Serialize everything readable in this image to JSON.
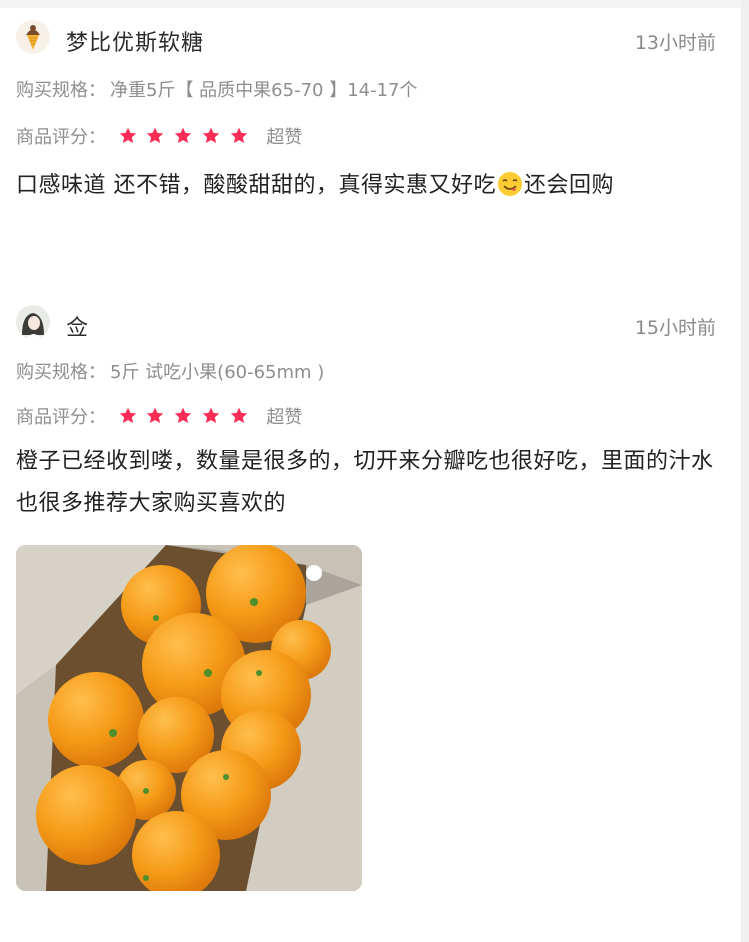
{
  "reviews": [
    {
      "username": "梦比优斯软糖",
      "time": "13小时前",
      "spec_label": "购买规格：",
      "spec_value": "净重5斤【 品质中果65-70 】14-17个",
      "rating_label": "商品评分：",
      "rating_stars": 5,
      "rating_text": "超赞",
      "text_part1": "口感味道 还不错，酸酸甜甜的，真得实惠又好吃",
      "text_part2": "还会回购",
      "avatar_icon": "soft-serve-avatar-icon"
    },
    {
      "username": "佥",
      "time": "15小时前",
      "spec_label": "购买规格：",
      "spec_value": "5斤  试吃小果(60-65mm )",
      "rating_label": "商品评分：",
      "rating_stars": 5,
      "rating_text": "超赞",
      "text": "橙子已经收到喽，数量是很多的，切开来分瓣吃也很好吃，里面的汁水也很多推荐大家购买喜欢的",
      "avatar_icon": "portrait-avatar-icon",
      "photo_icon": "oranges-in-box-photo"
    }
  ],
  "colors": {
    "star": "#ff2d55",
    "meta": "#8e8e8e",
    "text": "#222222"
  }
}
